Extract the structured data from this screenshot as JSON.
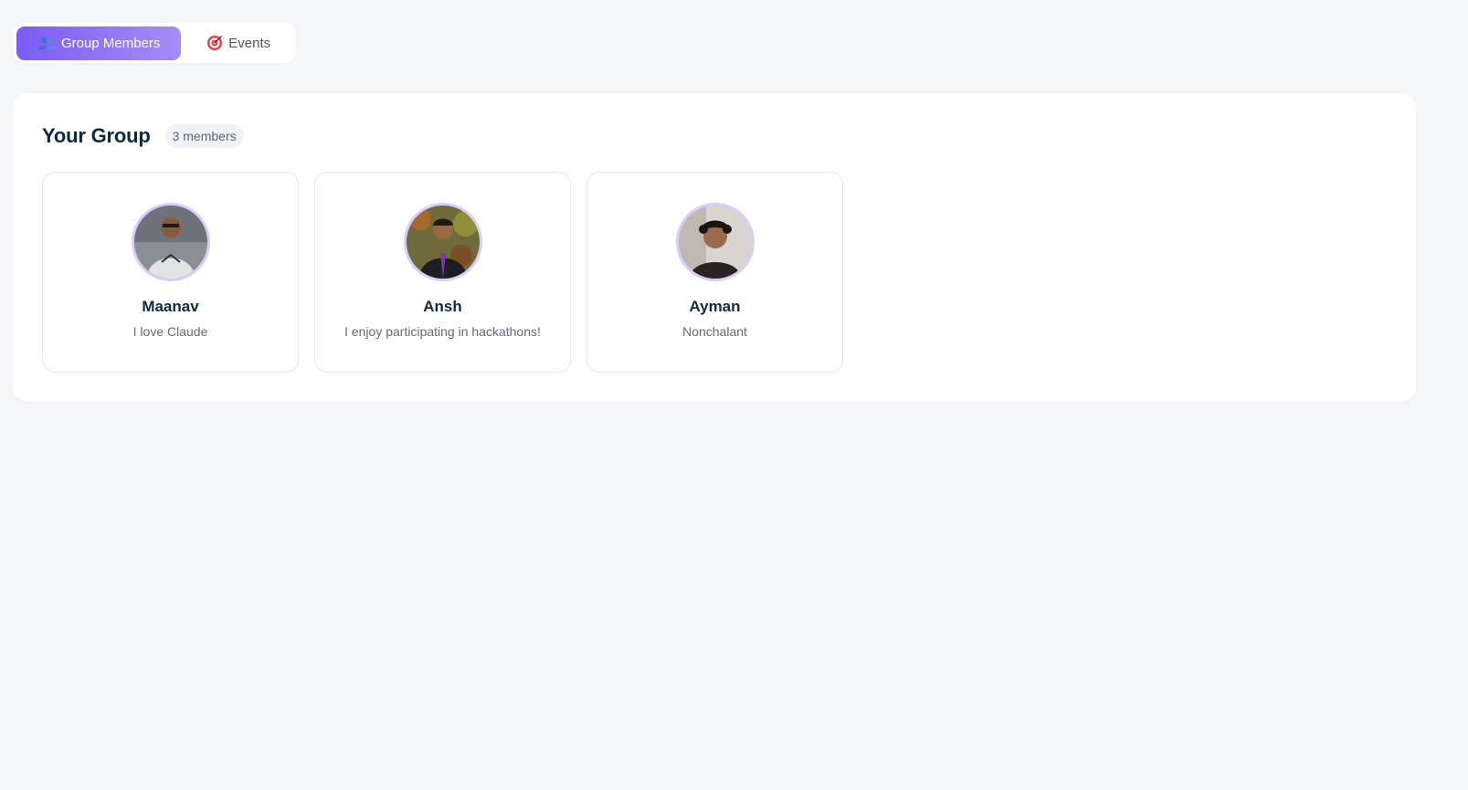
{
  "tabs": [
    {
      "label": "Group Members",
      "icon": "people-icon",
      "active": true
    },
    {
      "label": "Events",
      "icon": "target-icon",
      "active": false
    }
  ],
  "group": {
    "title": "Your Group",
    "member_count": "3 members"
  },
  "members": [
    {
      "name": "Maanav",
      "bio": "I love Claude",
      "avatar": "avatar-photo"
    },
    {
      "name": "Ansh",
      "bio": "I enjoy participating in hackathons!",
      "avatar": "avatar-photo"
    },
    {
      "name": "Ayman",
      "bio": "Nonchalant",
      "avatar": "avatar-photo"
    }
  ],
  "colors": {
    "accent_start": "#7b5cf5",
    "accent_end": "#a58cf6",
    "page_bg": "#f5f6f8",
    "title": "#0f2a3f",
    "avatar_ring": "#d9ccfb"
  }
}
